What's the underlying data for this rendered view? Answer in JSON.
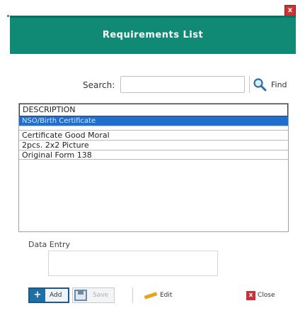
{
  "window": {
    "title": "Requirements List",
    "close_glyph": "x"
  },
  "search": {
    "label": "Search:",
    "value": "",
    "placeholder": "",
    "find_label": "Find",
    "icon": "magnifier-icon"
  },
  "list": {
    "header": "DESCRIPTION",
    "selected_item": "NSO/Birth Certificate",
    "items": [
      "Certificate Good Moral",
      "2pcs. 2x2 Picture",
      "Original Form 138"
    ]
  },
  "entry": {
    "label": "Data Entry",
    "value": ""
  },
  "toolbar": {
    "add_label": "Add",
    "save_label": "Save",
    "edit_label": "Edit",
    "close_label": "Close"
  },
  "colors": {
    "header_bg": "#108a74",
    "selection_bg": "#1e6fd0",
    "close_red": "#c93434"
  }
}
